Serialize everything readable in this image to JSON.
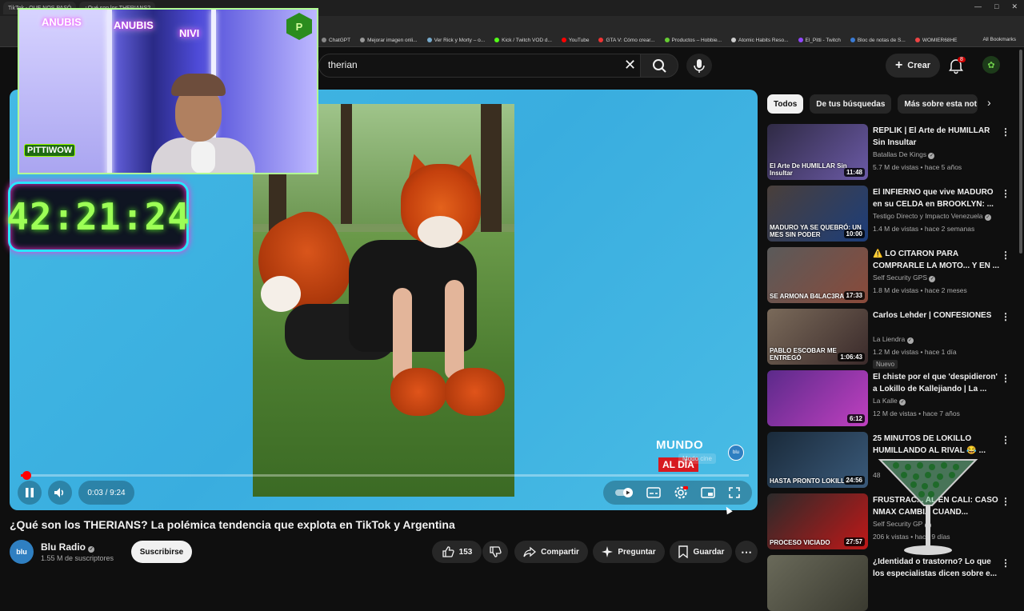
{
  "browser": {
    "tabs": [
      "TikTok - QUE NOS PASÓ",
      "¿Qué son los THERIANS?"
    ],
    "bookmarks": [
      "ChatGPT",
      "Mejorar imagen onli...",
      "Ver Rick y Morty – o...",
      "Kick / Twitch VOD d...",
      "YouTube",
      "GTA V: Cómo crear...",
      "Productos – Hobbie...",
      "Atomic Habits Reso...",
      "El_Pitti - Twitch",
      "Bloc de notas de S...",
      "WOMIER68HE"
    ],
    "all_bookmarks": "All Bookmarks"
  },
  "header": {
    "search_value": "therian",
    "create_label": "Crear",
    "notif_count": "8"
  },
  "overlay": {
    "timer": "42:21:24",
    "webcam_brand": "PITTIWOW",
    "neon_1": "ANUBIS",
    "neon_2": "ANUBIS",
    "neon_3": "NIVI"
  },
  "player": {
    "time": "0:03 / 9:24",
    "progress": 0.005,
    "brand_line1": "MUNDO",
    "brand_line2": "AL DÍA",
    "cinema_label": "Modo cine",
    "channel_mark": "blu"
  },
  "video": {
    "title": "¿Qué son los THERIANS? La polémica tendencia que explota en TikTok y Argentina",
    "channel": "Blu Radio",
    "channel_avatar": "blu",
    "subscribers": "1.55 M de suscriptores",
    "subscribe_label": "Suscribirse",
    "likes": "153",
    "share_label": "Compartir",
    "ask_label": "Preguntar",
    "save_label": "Guardar"
  },
  "sidebar": {
    "chips": [
      "Todos",
      "De tus búsquedas",
      "Más sobre esta not"
    ],
    "items": [
      {
        "title": "REPLIK | El Arte de HUMILLAR Sin Insultar",
        "channel": "Batallas De Kings",
        "meta": "5.7 M de vistas • hace 5 años",
        "duration": "11:48",
        "thumb_caption": "El Arte De HUMILLAR Sin Insultar",
        "colors": [
          "#2f2a44",
          "#6b5aa6"
        ]
      },
      {
        "title": "El INFIERNO que vive MADURO en su CELDA en BROOKLYN: ...",
        "channel": "Testigo Directo y Impacto Venezuela",
        "meta": "1.4 M de vistas • hace 2 semanas",
        "duration": "10:00",
        "thumb_caption": "MADURO YA SE QUEBRÓ: UN MES SIN PODER",
        "colors": [
          "#4a3f3a",
          "#1c3d7a"
        ]
      },
      {
        "title": "⚠️ LO CITARON PARA COMPRARLE LA MOTO... Y EN ...",
        "channel": "Self Security GPS",
        "meta": "1.8 M de vistas • hace 2 meses",
        "duration": "17:33",
        "thumb_caption": "SE ARMONA B4LAC3RA",
        "colors": [
          "#5a5a5a",
          "#8a4a3a"
        ]
      },
      {
        "title": "Carlos Lehder | CONFESIONES",
        "channel": "La Liendra",
        "meta": "1.2 M de vistas • hace 1 día",
        "duration": "1:06:43",
        "badge": "Nuevo",
        "thumb_caption": "PABLO ESCOBAR ME ENTREGÓ",
        "colors": [
          "#7a6a5a",
          "#3a2a2a"
        ]
      },
      {
        "title": "El chiste por el que 'despidieron' a Lokillo de Kallejiando | La ...",
        "channel": "La Kalle",
        "meta": "12 M de vistas • hace 7 años",
        "duration": "6:12",
        "thumb_caption": "",
        "colors": [
          "#5b2a8a",
          "#c040c0"
        ]
      },
      {
        "title": "25 MINUTOS DE LOKILLO HUMILLANDO AL RIVAL 😂 ...",
        "channel": "",
        "meta": "48",
        "duration": "24:56",
        "thumb_caption": "HASTA PRONTO LOKILLO",
        "colors": [
          "#1a2a3a",
          "#3a5a7a"
        ]
      },
      {
        "title": "FRUSTRAC... AL EN CALI: CASO NMAX CAMBIA CUAND...",
        "channel": "Self Security GP",
        "meta": "206 k vistas • hace 9 días",
        "duration": "27:57",
        "thumb_caption": "PROCESO VICIADO",
        "colors": [
          "#2a2a2a",
          "#c01818"
        ]
      },
      {
        "title": "¿Identidad o trastorno? Lo que los especialistas dicen sobre e...",
        "channel": "",
        "meta": "",
        "duration": "",
        "thumb_caption": "",
        "colors": [
          "#6a6a5a",
          "#3a3a30"
        ]
      }
    ]
  },
  "colors": {
    "accent": "#ff0000",
    "player_bg": "#43b9e4",
    "timer_text": "#9dff56"
  }
}
